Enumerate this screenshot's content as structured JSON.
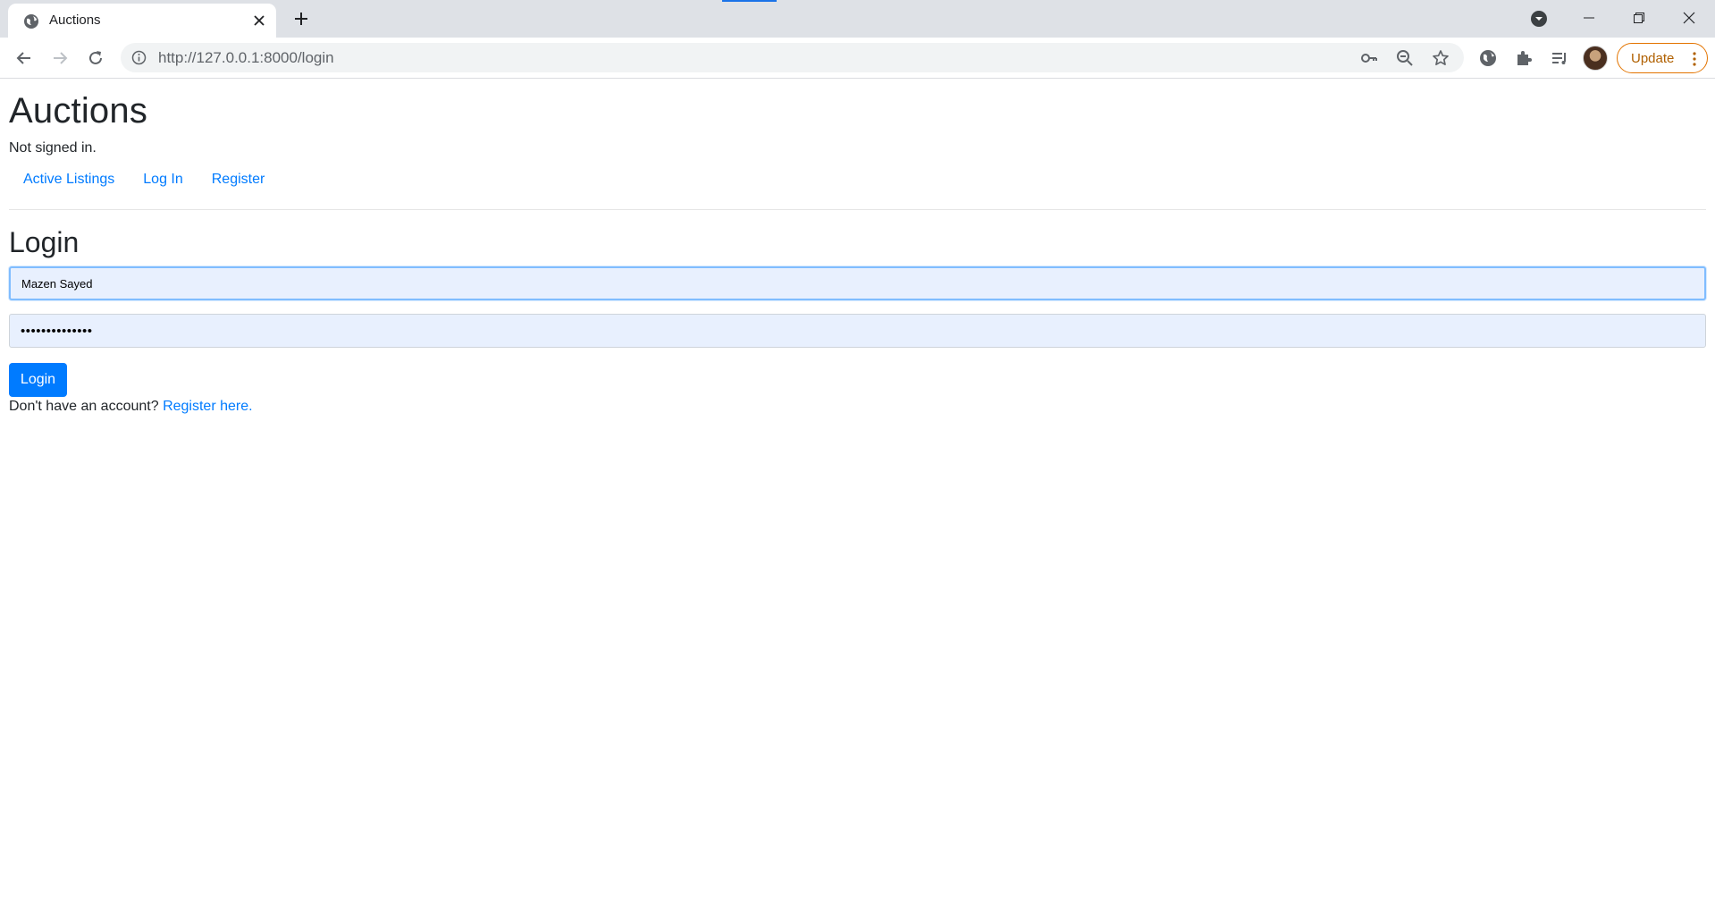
{
  "browser": {
    "tab_title": "Auctions",
    "url_host": "http://127.0.0.1",
    "url_rest": ":8000/login",
    "update_label": "Update"
  },
  "page": {
    "site_title": "Auctions",
    "signin_status": "Not signed in.",
    "nav": {
      "active_listings": "Active Listings",
      "log_in": "Log In",
      "register": "Register"
    },
    "login_heading": "Login",
    "username_value": "Mazen Sayed",
    "password_value": "••••••••••••••",
    "login_button": "Login",
    "register_prompt_text": "Don't have an account?",
    "register_link": "Register here."
  },
  "colors": {
    "link": "#007bff",
    "primary_button": "#007bff",
    "autofill_bg": "#e8f0fe",
    "update_accent": "#e37400"
  }
}
